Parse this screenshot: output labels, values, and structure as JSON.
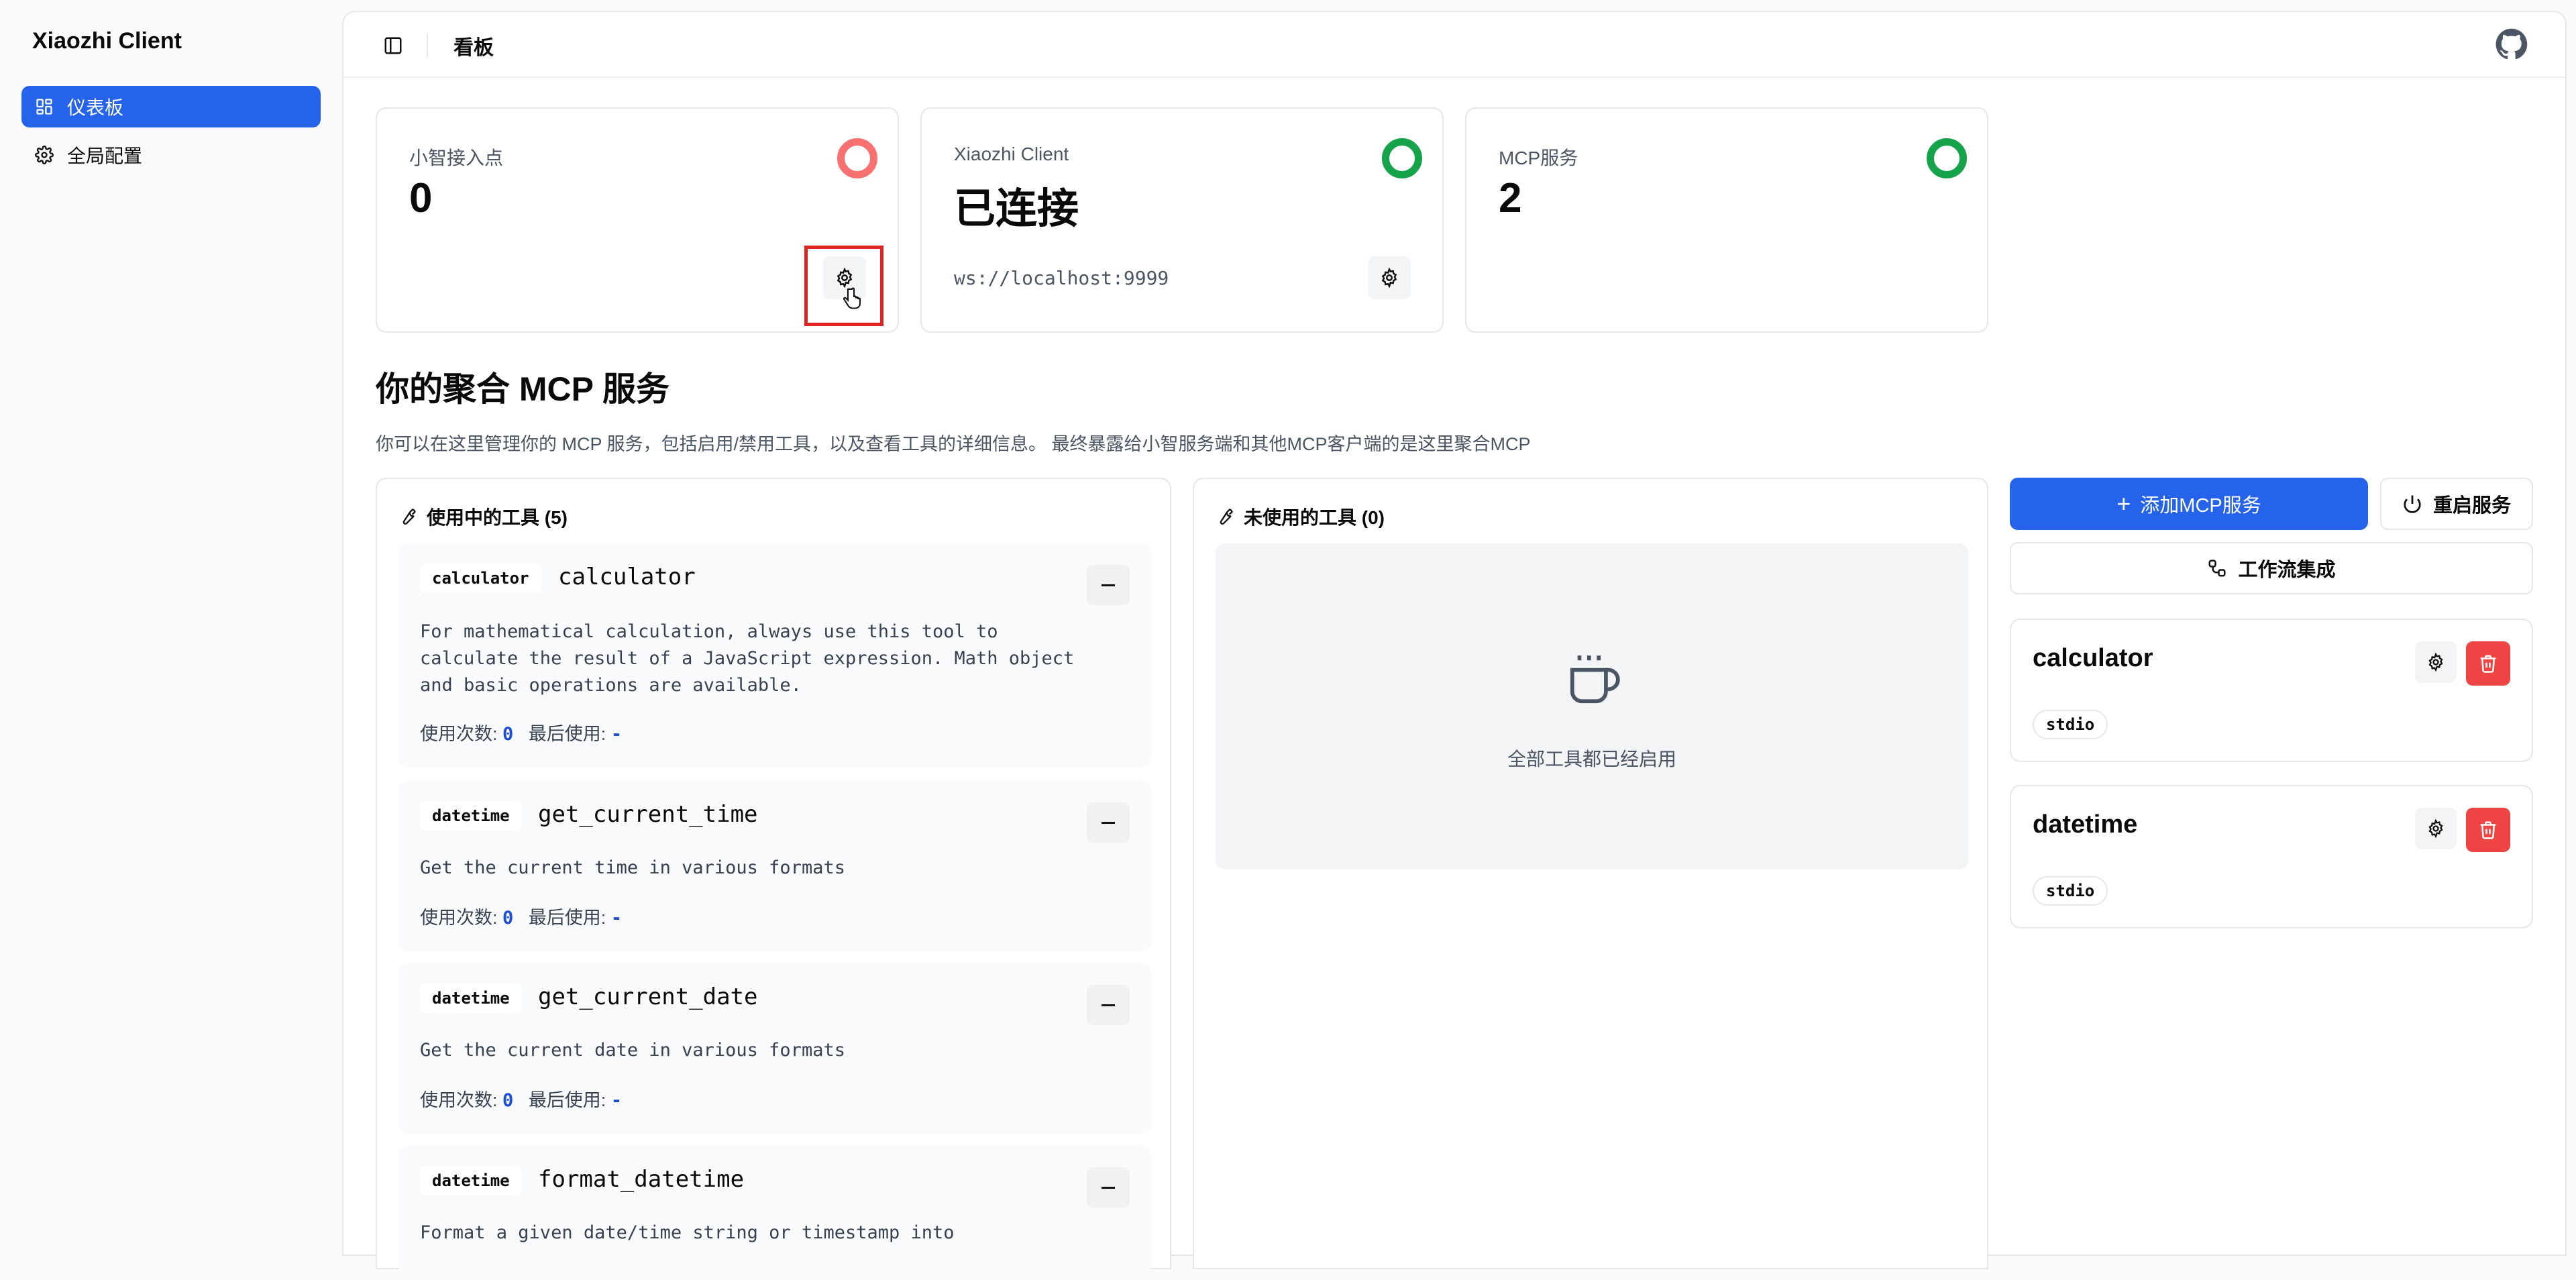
{
  "app": {
    "title": "Xiaozhi Client"
  },
  "sidebar": {
    "items": [
      {
        "label": "仪表板",
        "icon": "dashboard-icon",
        "active": true
      },
      {
        "label": "全局配置",
        "icon": "gear-icon",
        "active": false
      }
    ]
  },
  "header": {
    "breadcrumb": "看板",
    "github_icon": "github-icon"
  },
  "stats": [
    {
      "title": "小智接入点",
      "value": "0",
      "status": "disconnected",
      "status_color": "#f87171"
    },
    {
      "title": "Xiaozhi Client",
      "value": "已连接",
      "sub": "ws://localhost:9999",
      "status": "connected",
      "status_color": "#16a34a"
    },
    {
      "title": "MCP服务",
      "value": "2",
      "status": "connected",
      "status_color": "#16a34a"
    }
  ],
  "section": {
    "title": "你的聚合 MCP 服务",
    "description": "你可以在这里管理你的 MCP 服务，包括启用/禁用工具，以及查看工具的详细信息。 最终暴露给小智服务端和其他MCP客户端的是这里聚合MCP"
  },
  "used_tools": {
    "header": "使用中的工具 (5)",
    "usage_label": "使用次数:",
    "last_used_label": "最后使用:",
    "items": [
      {
        "server": "calculator",
        "name": "calculator",
        "description": "For mathematical calculation, always use this tool to calculate the result of a JavaScript expression. Math object and basic operations are available.",
        "count": "0",
        "last": "-"
      },
      {
        "server": "datetime",
        "name": "get_current_time",
        "description": "Get the current time in various formats",
        "count": "0",
        "last": "-"
      },
      {
        "server": "datetime",
        "name": "get_current_date",
        "description": "Get the current date in various formats",
        "count": "0",
        "last": "-"
      },
      {
        "server": "datetime",
        "name": "format_datetime",
        "description": "Format a given date/time string or timestamp into"
      }
    ]
  },
  "unused_tools": {
    "header": "未使用的工具 (0)",
    "empty_text": "全部工具都已经启用"
  },
  "actions": {
    "add": "添加MCP服务",
    "restart": "重启服务",
    "workflow": "工作流集成"
  },
  "services": [
    {
      "name": "calculator",
      "transport": "stdio"
    },
    {
      "name": "datetime",
      "transport": "stdio"
    }
  ],
  "colors": {
    "accent": "#2563eb",
    "danger": "#ef4444",
    "success": "#16a34a",
    "disconnected": "#f87171"
  }
}
